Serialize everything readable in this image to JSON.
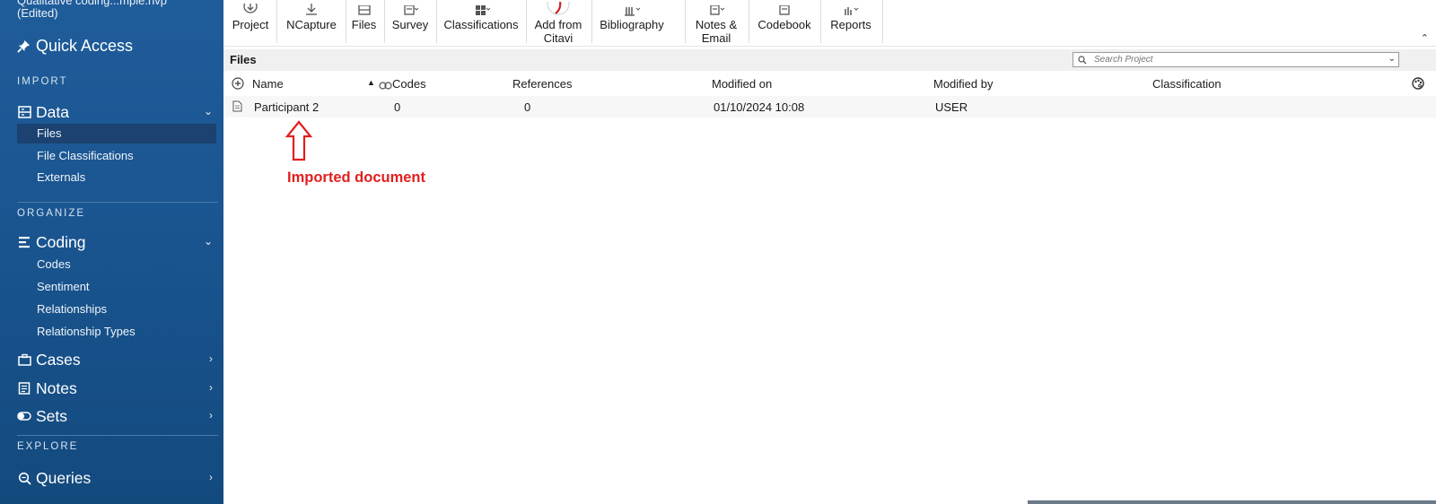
{
  "sidebar": {
    "project_title_line1": "Qualitative coding...mple.nvp",
    "project_title_line2": "(Edited)",
    "quick_access": "Quick Access",
    "sections": {
      "import": "IMPORT",
      "organize": "ORGANIZE",
      "explore": "EXPLORE"
    },
    "data": {
      "label": "Data",
      "items": [
        "Files",
        "File Classifications",
        "Externals"
      ]
    },
    "coding": {
      "label": "Coding",
      "items": [
        "Codes",
        "Sentiment",
        "Relationships",
        "Relationship Types"
      ]
    },
    "cases": "Cases",
    "notes": "Notes",
    "sets": "Sets",
    "queries": "Queries",
    "selected_item": "Files"
  },
  "ribbon": {
    "project": "Project",
    "ncapture": "NCapture",
    "files": "Files",
    "survey": "Survey",
    "classifications": "Classifications",
    "add_from_citavi_1": "Add from",
    "add_from_citavi_2": "Citavi",
    "bibliography": "Bibliography",
    "notes_email_1": "Notes &",
    "notes_email_2": "Email",
    "codebook": "Codebook",
    "reports": "Reports"
  },
  "files_panel": {
    "title": "Files",
    "search_placeholder": "Search Project"
  },
  "table": {
    "columns": [
      "Name",
      "Codes",
      "References",
      "Modified on",
      "Modified by",
      "Classification"
    ],
    "rows": [
      {
        "name": "Participant 2",
        "codes": "0",
        "references": "0",
        "modified_on": "01/10/2024 10:08",
        "modified_by": "USER",
        "classification": ""
      }
    ]
  },
  "annotation": {
    "text": "Imported document",
    "color": "#e0201f"
  },
  "colors": {
    "sidebar": "#1a5590",
    "sidebar_selected": "#1b4270",
    "annotation": "#e0201f"
  }
}
